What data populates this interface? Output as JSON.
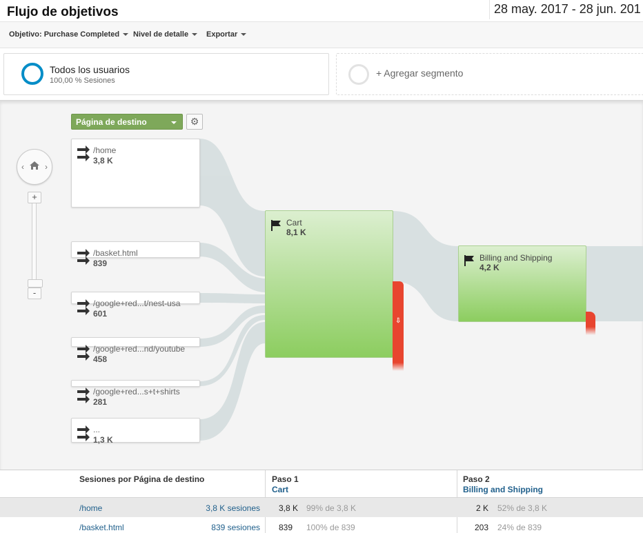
{
  "header": {
    "title": "Flujo de objetivos",
    "date_range": "28 may. 2017 - 28 jun. 201"
  },
  "toolbar": {
    "goal": "Objetivo: Purchase Completed",
    "detail": "Nivel de detalle",
    "export": "Exportar"
  },
  "segments": {
    "active_name": "Todos los usuarios",
    "active_sub": "100,00 % Sesiones",
    "add_label": "+ Agregar segmento"
  },
  "flow": {
    "dimension": "Página de destino",
    "zoom_in": "+",
    "zoom_out": "-",
    "sources": [
      {
        "label": "/home",
        "value": "3,8 K"
      },
      {
        "label": "/basket.html",
        "value": "839"
      },
      {
        "label": "/google+red...t/nest-usa",
        "value": "601"
      },
      {
        "label": "/google+red...nd/youtube",
        "value": "458"
      },
      {
        "label": "/google+red...s+t+shirts",
        "value": "281"
      },
      {
        "label": "...",
        "value": "1,3 K"
      }
    ],
    "steps": [
      {
        "label": "Cart",
        "value": "8,1 K"
      },
      {
        "label": "Billing and Shipping",
        "value": "4,2 K"
      }
    ]
  },
  "table": {
    "col1_header": "Sesiones por Página de destino",
    "col2_header": "Paso 1",
    "col2_sub": "Cart",
    "col3_header": "Paso 2",
    "col3_sub": "Billing and Shipping",
    "rows": [
      {
        "page": "/home",
        "sessions": "3,8 K sesiones",
        "step1": "3,8 K",
        "step1_pct": "99% de 3,8 K",
        "step2": "2 K",
        "step2_pct": "52% de 3,8 K"
      },
      {
        "page": "/basket.html",
        "sessions": "839 sesiones",
        "step1": "839",
        "step1_pct": "100% de 839",
        "step2": "203",
        "step2_pct": "24% de 839"
      }
    ]
  },
  "colors": {
    "step_green": "#8ccd5f",
    "dimension_green": "#7ea85a",
    "exit_red": "#e8452f",
    "link_blue": "#1f5f8b",
    "segment_blue": "#058dc7"
  }
}
